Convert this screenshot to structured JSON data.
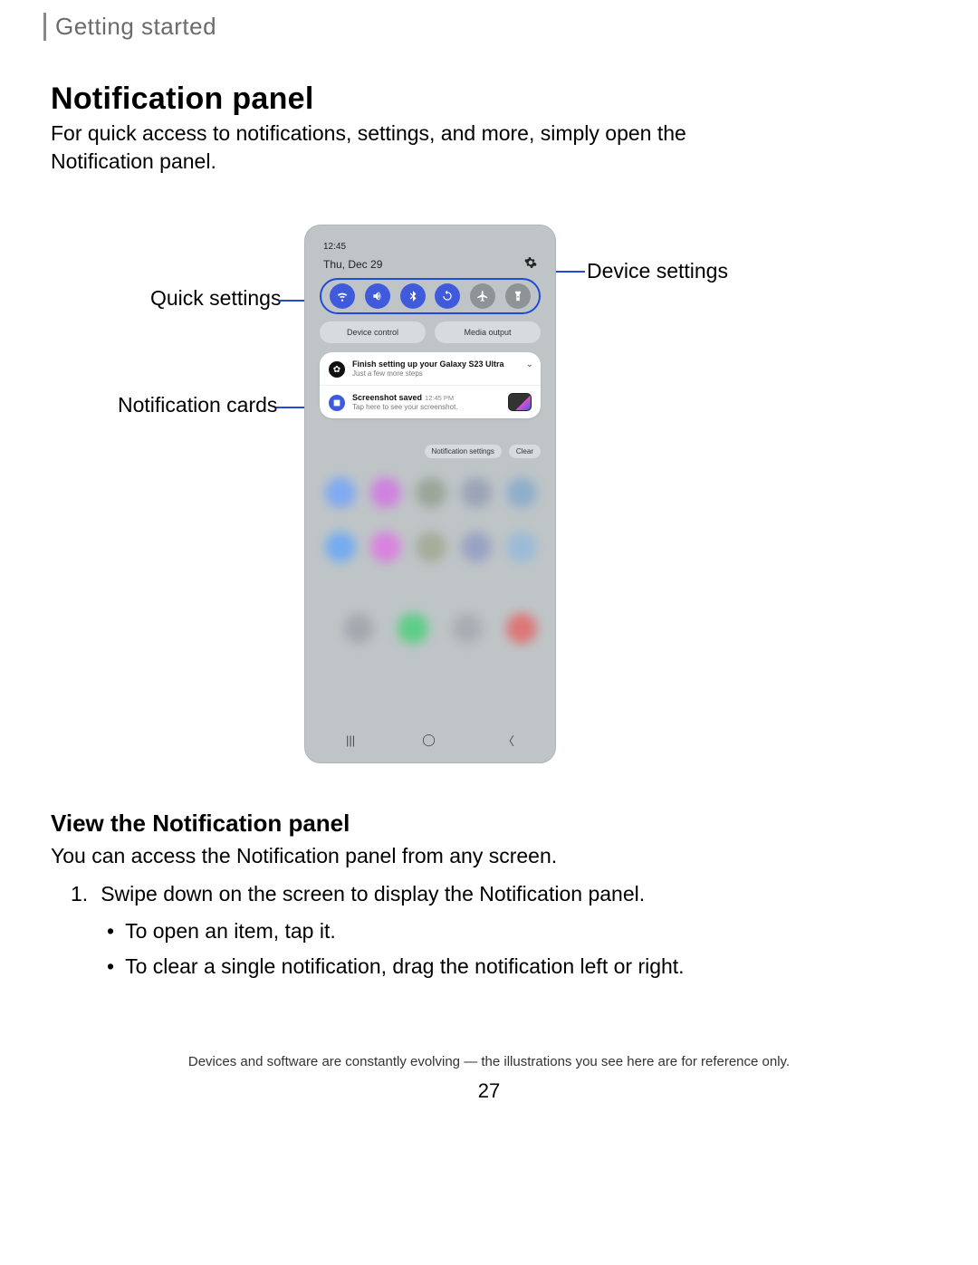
{
  "breadcrumb": "Getting started",
  "title": "Notification panel",
  "intro": "For quick access to notifications, settings, and more, simply open the Notification panel.",
  "callouts": {
    "quick": "Quick settings",
    "device": "Device settings",
    "cards": "Notification cards"
  },
  "phone": {
    "time": "12:45",
    "date": "Thu, Dec 29",
    "chips": {
      "device_control": "Device control",
      "media_output": "Media output"
    },
    "qs_icons": [
      "wifi-icon",
      "volume-icon",
      "bluetooth-icon",
      "rotate-icon",
      "airplane-icon",
      "flashlight-icon"
    ],
    "card1": {
      "title": "Finish setting up your Galaxy S23 Ultra",
      "sub": "Just a few more steps"
    },
    "card2": {
      "title": "Screenshot saved",
      "time": "12:45 PM",
      "sub": "Tap here to see your screenshot."
    },
    "footer": {
      "settings": "Notification settings",
      "clear": "Clear"
    }
  },
  "section2": {
    "heading": "View the Notification panel",
    "body": "You can access the Notification panel from any screen.",
    "step_num": "1.",
    "step_text": "Swipe down on the screen to display the Notification panel.",
    "bullets": [
      "To open an item, tap it.",
      "To clear a single notification, drag the notification left or right."
    ]
  },
  "footnote": "Devices and software are constantly evolving — the illustrations you see here are for reference only.",
  "pagenum": "27"
}
